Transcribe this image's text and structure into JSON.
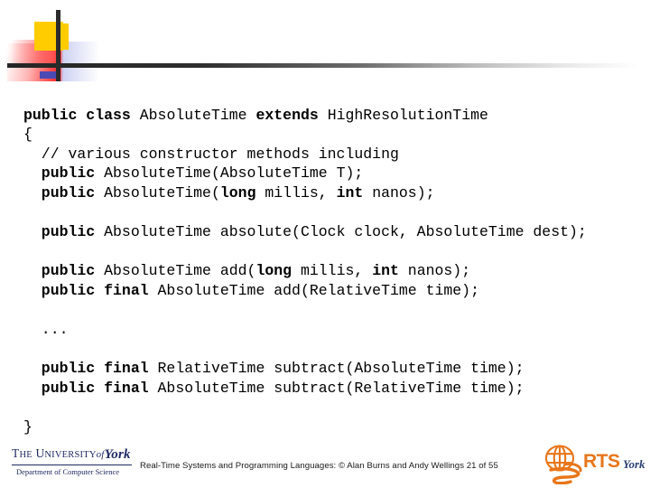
{
  "slide": {
    "header_motif": {
      "yellow": "#ffcc00",
      "red": "#ff3333",
      "blue": "#4a4ab4",
      "bar": "#2b2b2b"
    },
    "code": {
      "language": "java",
      "lines": [
        [
          {
            "t": "public class ",
            "b": true
          },
          {
            "t": "AbsoluteTime ",
            "b": false
          },
          {
            "t": "extends ",
            "b": true
          },
          {
            "t": "HighResolutionTime",
            "b": false
          }
        ],
        [
          {
            "t": "{",
            "b": false
          }
        ],
        [
          {
            "t": "  // various constructor methods including",
            "b": false
          }
        ],
        [
          {
            "t": "  public ",
            "b": true
          },
          {
            "t": "AbsoluteTime(AbsoluteTime T);",
            "b": false
          }
        ],
        [
          {
            "t": "  public ",
            "b": true
          },
          {
            "t": "AbsoluteTime(",
            "b": false
          },
          {
            "t": "long ",
            "b": true
          },
          {
            "t": "millis, ",
            "b": false
          },
          {
            "t": "int ",
            "b": true
          },
          {
            "t": "nanos);",
            "b": false
          }
        ],
        [],
        [
          {
            "t": "  public ",
            "b": true
          },
          {
            "t": "AbsoluteTime absolute(Clock clock, AbsoluteTime dest);",
            "b": false
          }
        ],
        [],
        [
          {
            "t": "  public ",
            "b": true
          },
          {
            "t": "AbsoluteTime add(",
            "b": false
          },
          {
            "t": "long ",
            "b": true
          },
          {
            "t": "millis, ",
            "b": false
          },
          {
            "t": "int ",
            "b": true
          },
          {
            "t": "nanos);",
            "b": false
          }
        ],
        [
          {
            "t": "  public final ",
            "b": true
          },
          {
            "t": "AbsoluteTime add(RelativeTime time);",
            "b": false
          }
        ],
        [],
        [
          {
            "t": "  ...",
            "b": false
          }
        ],
        [],
        [
          {
            "t": "  public final ",
            "b": true
          },
          {
            "t": "RelativeTime subtract(AbsoluteTime time);",
            "b": false
          }
        ],
        [
          {
            "t": "  public final ",
            "b": true
          },
          {
            "t": "AbsoluteTime subtract(RelativeTime time);",
            "b": false
          }
        ],
        [],
        [
          {
            "t": "}",
            "b": false
          }
        ]
      ]
    },
    "footer": {
      "york_logo": {
        "the": "T",
        "he": "HE",
        "university_u": "U",
        "university_rest": "NIVERSITY",
        "of": "of",
        "york": "York",
        "department": "Department of Computer Science",
        "color": "#1f2a63"
      },
      "credit": "Real-Time Systems and Programming Languages: © Alan Burns and Andy Wellings 21 of 55",
      "rts_logo": {
        "acronym": "RTS",
        "york": "York",
        "acronym_color": "#e8761a",
        "york_color": "#2b3f74"
      }
    }
  }
}
